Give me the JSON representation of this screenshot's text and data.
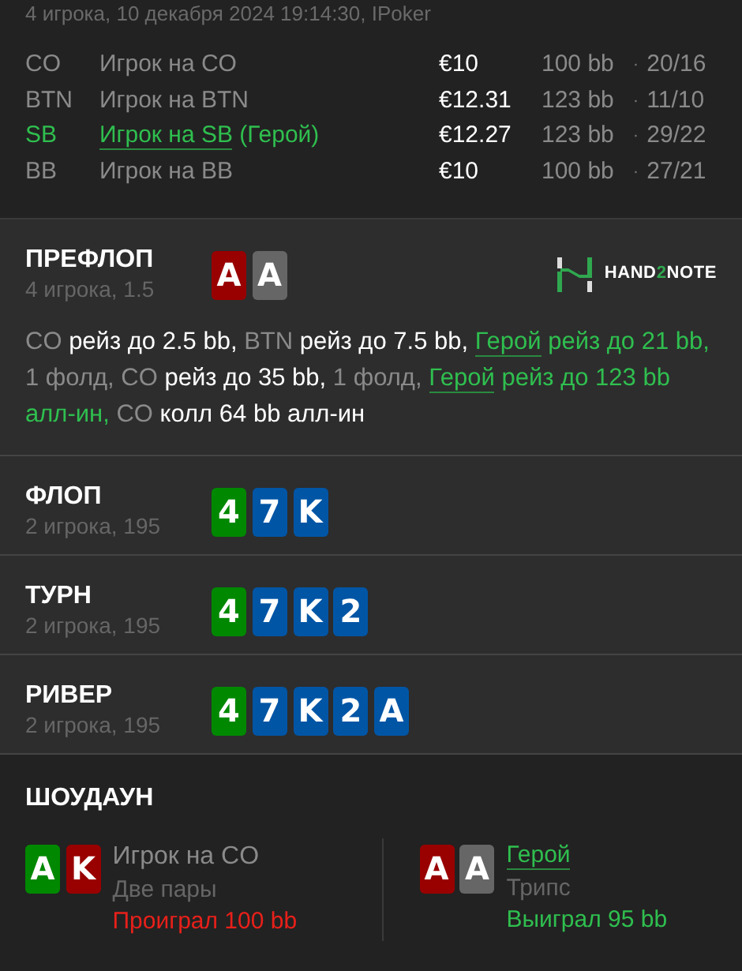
{
  "header": {
    "subtitle": "4 игрока, 10 декабря 2024 19:14:30, IPoker"
  },
  "players": [
    {
      "position": "CO",
      "name": "Игрок на CO",
      "hero": false,
      "stack": "€10",
      "bb": "100 bb",
      "sep": "·",
      "stats": "20/16"
    },
    {
      "position": "BTN",
      "name": "Игрок на BTN",
      "hero": false,
      "stack": "€12.31",
      "bb": "123 bb",
      "sep": "·",
      "stats": "11/10"
    },
    {
      "position": "SB",
      "name": "Игрок на SB",
      "hero": true,
      "hero_tag": "(Герой)",
      "stack": "€12.27",
      "bb": "123 bb",
      "sep": "·",
      "stats": "29/22"
    },
    {
      "position": "BB",
      "name": "Игрок на BB",
      "hero": false,
      "stack": "€10",
      "bb": "100 bb",
      "sep": "·",
      "stats": "27/21"
    }
  ],
  "streets": [
    {
      "title": "ПРЕФЛОП",
      "info": "4 игрока, 1.5",
      "cards": [
        {
          "rank": "A",
          "color": "#990000"
        },
        {
          "rank": "A",
          "color": "#666666"
        }
      ],
      "logo": {
        "parts": [
          {
            "text": "HAND",
            "accent": false
          },
          {
            "text": "2",
            "accent": true
          },
          {
            "text": "NOTE",
            "accent": false
          }
        ]
      },
      "actions": [
        {
          "kind": "muted",
          "text": "CO "
        },
        {
          "kind": "strong",
          "text": "рейз до 2.5 bb, "
        },
        {
          "kind": "muted",
          "text": "BTN "
        },
        {
          "kind": "strong",
          "text": "рейз до 7.5 bb, "
        },
        {
          "kind": "hero-link",
          "text": "Герой"
        },
        {
          "kind": "hero",
          "text": " рейз до 21 bb, "
        },
        {
          "kind": "muted",
          "text": "1 фолд, CO "
        },
        {
          "kind": "strong",
          "text": "рейз до 35 bb, "
        },
        {
          "kind": "muted",
          "text": "1 фолд, "
        },
        {
          "kind": "hero-link",
          "text": "Герой"
        },
        {
          "kind": "hero",
          "text": " рейз до 123 bb алл-ин, "
        },
        {
          "kind": "muted",
          "text": "CO "
        },
        {
          "kind": "strong",
          "text": "колл 64 bb алл-ин"
        }
      ]
    },
    {
      "title": "ФЛОП",
      "info": "2 игрока, 195",
      "cards": [
        {
          "rank": "4",
          "color": "#008800"
        },
        {
          "rank": "7",
          "color": "#0055a5"
        },
        {
          "rank": "K",
          "color": "#0055a5"
        }
      ]
    },
    {
      "title": "ТУРН",
      "info": "2 игрока, 195",
      "cards": [
        {
          "rank": "4",
          "color": "#008800"
        },
        {
          "rank": "7",
          "color": "#0055a5"
        },
        {
          "rank": "K",
          "color": "#0055a5"
        },
        {
          "rank": "2",
          "color": "#0055a5"
        }
      ]
    },
    {
      "title": "РИВЕР",
      "info": "2 игрока, 195",
      "cards": [
        {
          "rank": "4",
          "color": "#008800"
        },
        {
          "rank": "7",
          "color": "#0055a5"
        },
        {
          "rank": "K",
          "color": "#0055a5"
        },
        {
          "rank": "2",
          "color": "#0055a5"
        },
        {
          "rank": "A",
          "color": "#0055a5"
        }
      ]
    }
  ],
  "showdown": {
    "title": "ШОУДАУН",
    "hands": [
      {
        "cards": [
          {
            "rank": "A",
            "color": "#008800"
          },
          {
            "rank": "K",
            "color": "#990000"
          }
        ],
        "name": "Игрок на CO",
        "hero": false,
        "combo": "Две пары",
        "result": "Проиграл 100 bb",
        "won": false
      },
      {
        "cards": [
          {
            "rank": "A",
            "color": "#990000"
          },
          {
            "rank": "A",
            "color": "#666666"
          }
        ],
        "name": "Герой",
        "hero": true,
        "combo": "Трипс",
        "result": "Выиграл 95 bb",
        "won": true
      }
    ]
  }
}
